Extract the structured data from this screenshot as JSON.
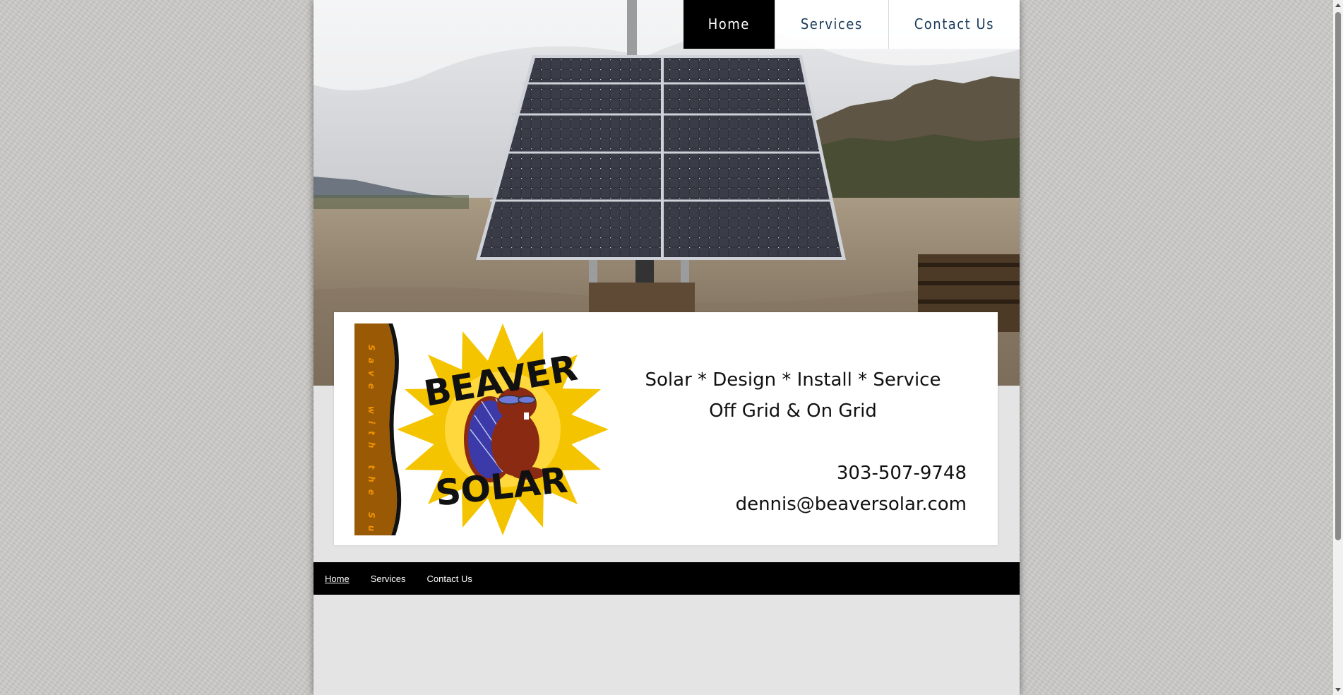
{
  "top_nav": {
    "items": [
      {
        "label": "Home",
        "active": true
      },
      {
        "label": "Services",
        "active": false
      },
      {
        "label": "Contact Us",
        "active": false
      }
    ]
  },
  "header": {
    "logo": {
      "text_top": "BEAVER",
      "text_bottom": "SOLAR",
      "banner_text": "Save with the Sun!",
      "colors": {
        "sun": "#f5c400",
        "banner": "#9a5a05",
        "beaver": "#8b2a12"
      }
    },
    "tagline_line1": "Solar * Design * Install * Service",
    "tagline_line2": "Off Grid & On Grid",
    "phone": "303-507-9748",
    "email": "dennis@beaversolar.com"
  },
  "bottom_nav": {
    "items": [
      {
        "label": "Home",
        "active": true
      },
      {
        "label": "Services",
        "active": false
      },
      {
        "label": "Contact Us",
        "active": false
      }
    ]
  },
  "colors": {
    "nav_active_bg": "#000000",
    "nav_text": "#1a3a5a",
    "footer_bar": "#000000",
    "page_bg": "#e4e4e4"
  }
}
